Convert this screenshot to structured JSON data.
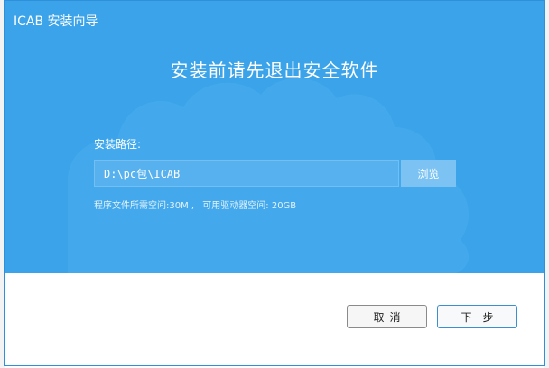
{
  "window": {
    "title": "ICAB 安装向导"
  },
  "banner": {
    "headline": "安装前请先退出安全软件"
  },
  "install": {
    "path_label": "安装路径:",
    "path_value": "D:\\pc包\\ICAB",
    "browse_label": "浏览",
    "required_space": "程序文件所需空间:30M ,",
    "available_space": "可用驱动器空间: 20GB"
  },
  "footer": {
    "cancel_label": "取消",
    "next_label": "下一步"
  },
  "colors": {
    "banner_bg": "#3aa3e9",
    "browse_bg": "#7cc3f4",
    "next_border": "#3a8fd0"
  }
}
